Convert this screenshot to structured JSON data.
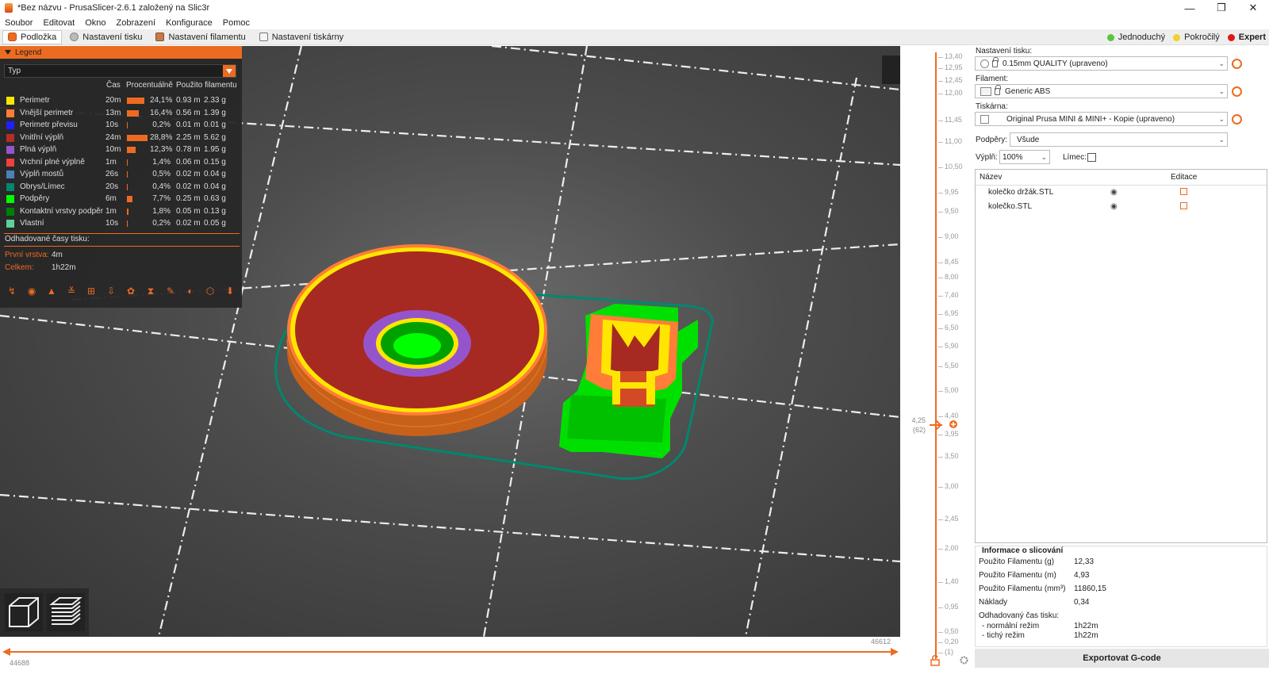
{
  "window": {
    "title": "*Bez názvu - PrusaSlicer-2.6.1 založený na Slic3r",
    "controls": [
      "—",
      "❐",
      "✕"
    ]
  },
  "menu": [
    "Soubor",
    "Editovat",
    "Okno",
    "Zobrazení",
    "Konfigurace",
    "Pomoc"
  ],
  "tabs": [
    {
      "label": "Podložka"
    },
    {
      "label": "Nastavení tisku"
    },
    {
      "label": "Nastavení filamentu"
    },
    {
      "label": "Nastavení tiskárny"
    }
  ],
  "modes": [
    {
      "label": "Jednoduchý",
      "color": "#5cc43c"
    },
    {
      "label": "Pokročilý",
      "color": "#f2d02e"
    },
    {
      "label": "Expert",
      "color": "#e01818"
    }
  ],
  "legend": {
    "title": "Legend",
    "type_select": "Typ",
    "columns": [
      "Čas",
      "Procentuálně",
      "Použito filamentu"
    ],
    "rows": [
      {
        "name": "Perimetr",
        "color": "#ffe600",
        "time": "20m",
        "percent": "24,1%",
        "pct_value": 24.1,
        "length": "0.93 m",
        "weight": "2.33 g"
      },
      {
        "name": "Vnější perimetr",
        "color": "#ff7d38",
        "time": "13m",
        "percent": "16,4%",
        "pct_value": 16.4,
        "length": "0.56 m",
        "weight": "1.39 g"
      },
      {
        "name": "Perimetr převisu",
        "color": "#1f1fff",
        "time": "10s",
        "percent": "0,2%",
        "pct_value": 0.2,
        "length": "0.01 m",
        "weight": "0.01 g"
      },
      {
        "name": "Vnitřní výplň",
        "color": "#b03029",
        "time": "24m",
        "percent": "28,8%",
        "pct_value": 28.8,
        "length": "2.25 m",
        "weight": "5.62 g"
      },
      {
        "name": "Plná výplň",
        "color": "#9654cc",
        "time": "10m",
        "percent": "12,3%",
        "pct_value": 12.3,
        "length": "0.78 m",
        "weight": "1.95 g"
      },
      {
        "name": "Vrchní plné výplně",
        "color": "#f04040",
        "time": "1m",
        "percent": "1,4%",
        "pct_value": 1.4,
        "length": "0.06 m",
        "weight": "0.15 g"
      },
      {
        "name": "Výplň mostů",
        "color": "#4d80ba",
        "time": "26s",
        "percent": "0,5%",
        "pct_value": 0.5,
        "length": "0.02 m",
        "weight": "0.04 g"
      },
      {
        "name": "Obrys/Límec",
        "color": "#00876e",
        "time": "20s",
        "percent": "0,4%",
        "pct_value": 0.4,
        "length": "0.02 m",
        "weight": "0.04 g"
      },
      {
        "name": "Podpěry",
        "color": "#00ff00",
        "time": "6m",
        "percent": "7,7%",
        "pct_value": 7.7,
        "length": "0.25 m",
        "weight": "0.63 g"
      },
      {
        "name": "Kontaktní vrstvy podpěr",
        "color": "#008000",
        "time": "1m",
        "percent": "1,8%",
        "pct_value": 1.8,
        "length": "0.05 m",
        "weight": "0.13 g"
      },
      {
        "name": "Vlastní",
        "color": "#5ed194",
        "time": "10s",
        "percent": "0,2%",
        "pct_value": 0.2,
        "length": "0.02 m",
        "weight": "0.05 g"
      }
    ],
    "estimate_title": "Odhadované časy tisku:",
    "first_layer_label": "První vrstva:",
    "first_layer_value": "4m",
    "total_label": "Celkem:",
    "total_value": "1h22m"
  },
  "hslider": {
    "left_value": "44688",
    "right_value": "46612"
  },
  "vslider": {
    "ticks": [
      "13,40",
      "12,95",
      "12,45",
      "12,00",
      "11,45",
      "11,00",
      "10,50",
      "9,95",
      "9,50",
      "9,00",
      "8,45",
      "8,00",
      "7,40",
      "6,95",
      "6,50",
      "5,90",
      "5,50",
      "5,00",
      "4,40",
      "3,95",
      "3,50",
      "3,00",
      "2,45",
      "2,00",
      "1,40",
      "0,95",
      "0,50",
      "0,20",
      "(1)"
    ],
    "current_height": "4,25",
    "current_layer": "(62)"
  },
  "right_panel": {
    "print_settings_label": "Nastavení tisku:",
    "print_settings_value": "0.15mm QUALITY (upraveno)",
    "filament_label": "Filament:",
    "filament_value": "Generic ABS",
    "printer_label": "Tiskárna:",
    "printer_value": "Original Prusa MINI & MINI+ - Kopie (upraveno)",
    "supports_label": "Podpěry:",
    "supports_value": "Všude",
    "infill_label": "Výplň:",
    "infill_value": "100%",
    "brim_label": "Límec:",
    "objects_header_name": "Název",
    "objects_header_edit": "Editace",
    "objects": [
      {
        "name": "kolečko držák.STL"
      },
      {
        "name": "kolečko.STL"
      }
    ],
    "slicing_info_title": "Informace o slicování",
    "slicing_info": [
      {
        "key": "Použito Filamentu (g)",
        "value": "12,33"
      },
      {
        "key": "Použito Filamentu (m)",
        "value": "4,93"
      },
      {
        "key": "Použito Filamentu (mm³)",
        "value": "11860,15"
      },
      {
        "key": "Náklady",
        "value": "0,34"
      }
    ],
    "est_time_title": "Odhadovaný čas tisku:",
    "est_normal_label": "- normální režim",
    "est_normal_value": "1h22m",
    "est_silent_label": "- tichý režim",
    "est_silent_value": "1h22m",
    "export_label": "Exportovat G-code"
  },
  "colors": {
    "accent": "#ed6b21"
  }
}
